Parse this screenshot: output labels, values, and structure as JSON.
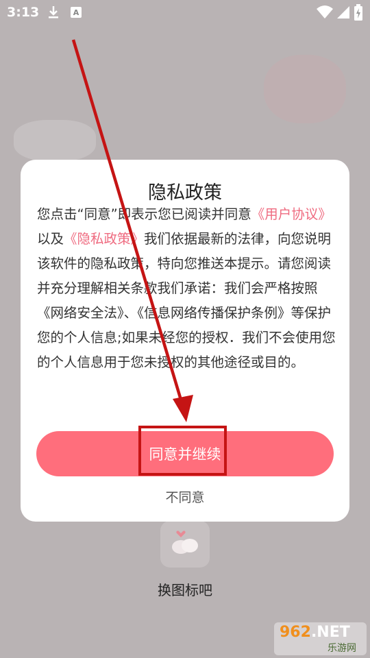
{
  "status_bar": {
    "time": "3:13",
    "icons": [
      "download-icon",
      "font-app-icon",
      "wifi-icon",
      "signal-icon",
      "battery-charging-icon"
    ]
  },
  "background": {
    "app_icon_label": "换图标吧"
  },
  "dialog": {
    "title": "隐私政策",
    "body": {
      "p1": "您点击“同意”即表示您已阅读并同意",
      "link_user_agreement": "《用户协议》",
      "p2": "以及",
      "link_privacy_policy": "《隐私政策》",
      "p3": "我们依据最新的法律，向您说明该软件的隐私政策，特向您推送本提示。请您阅读并充分理解相关条款我们承诺：我们会严格按照《网络安全法》、《信息网络传播保护条例》等保护您的个人信息;如果未经您的授权．我们不会使用您的个人信息用于您未授权的其他途径或目的。"
    },
    "agree_label": "同意并继续",
    "disagree_label": "不同意"
  },
  "watermark": {
    "number": "962",
    "suffix": ".NET",
    "site": "乐游网"
  },
  "colors": {
    "accent": "#ff6e7c",
    "link": "#ef6b80",
    "annotation": "#c51414"
  }
}
